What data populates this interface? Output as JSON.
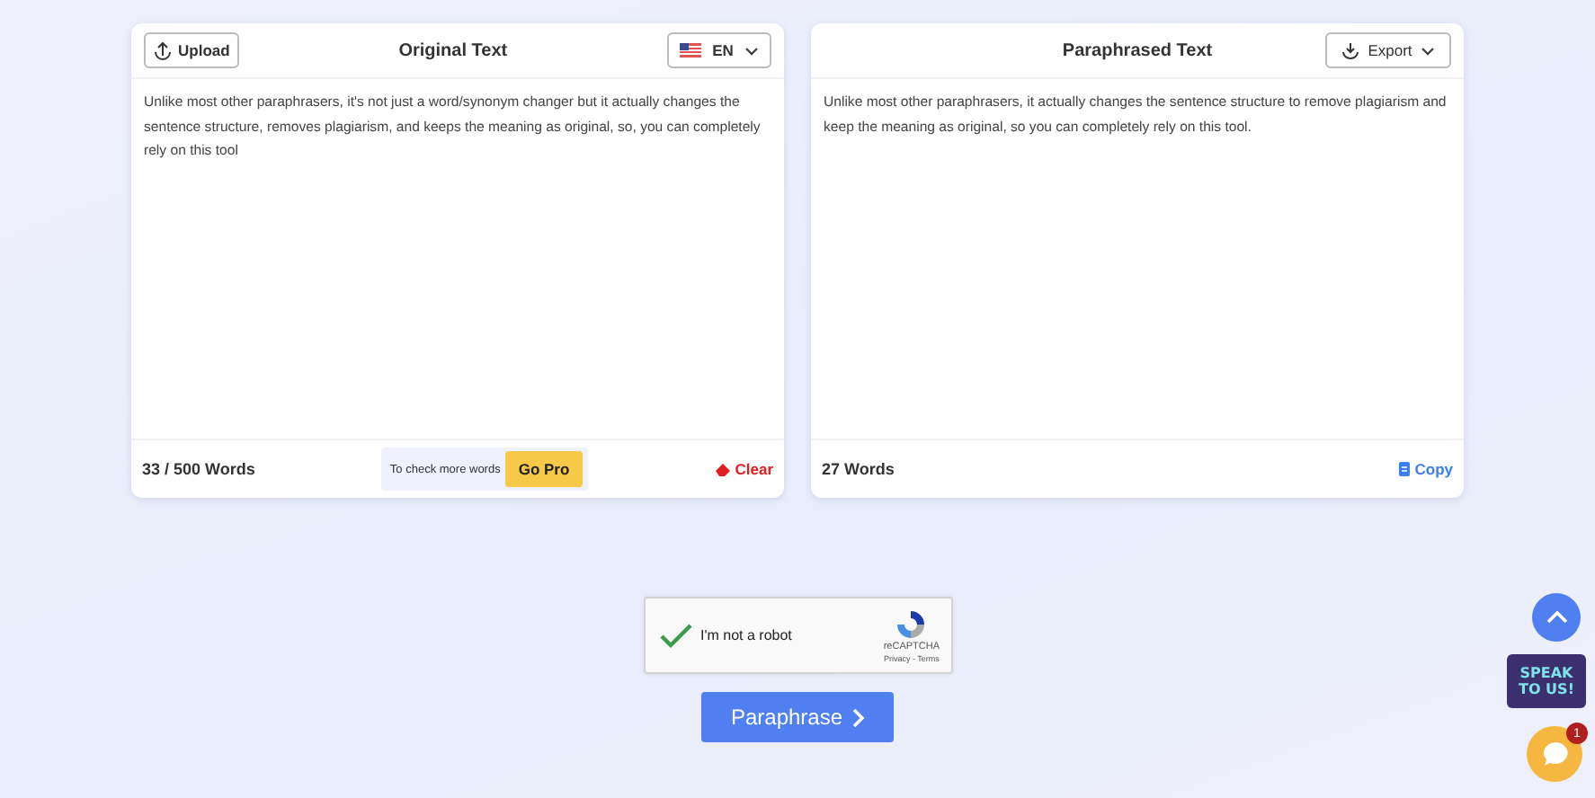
{
  "original_panel": {
    "upload_label": "Upload",
    "title": "Original Text",
    "language": "EN",
    "text": "Unlike most other paraphrasers, it's not just a word/synonym changer but it actually changes the sentence structure, removes plagiarism, and keeps the meaning as original, so, you can completely rely on this tool",
    "word_count": "33 / 500 Words",
    "promo_text": "To check more words",
    "pro_button": "Go Pro",
    "clear_label": "Clear"
  },
  "paraphrased_panel": {
    "title": "Paraphrased Text",
    "export_label": "Export",
    "text": "Unlike most other paraphrasers, it actually changes the sentence structure to remove plagiarism and keep the meaning as original, so you can completely rely on this tool.",
    "word_count": "27 Words",
    "copy_label": "Copy"
  },
  "captcha": {
    "label": "I'm not a robot",
    "checked": true,
    "brand": "reCAPTCHA",
    "links": "Privacy - Terms"
  },
  "paraphrase_button": "Paraphrase",
  "speak_badge": {
    "line_1": "SPEAK",
    "line_2": "TO US!"
  },
  "chat": {
    "unread": "1"
  }
}
